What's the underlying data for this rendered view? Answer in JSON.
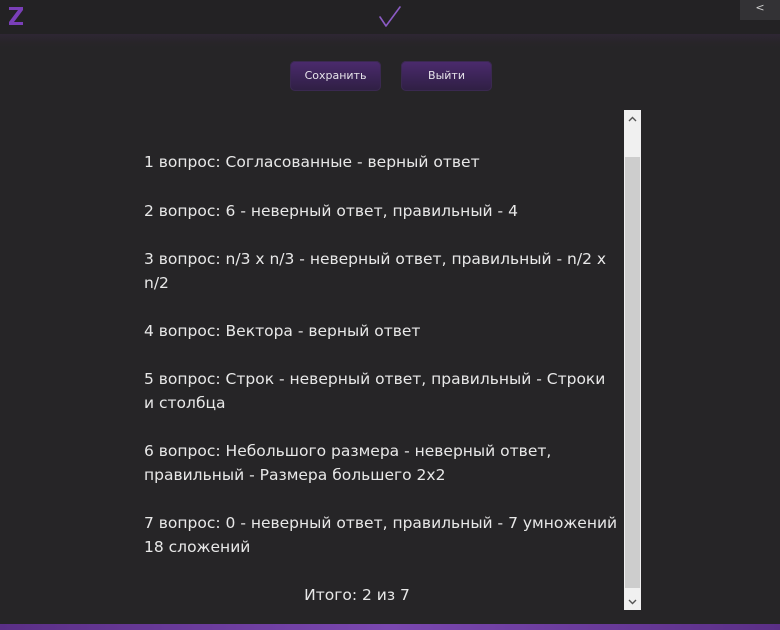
{
  "header": {
    "collapse_label": "<"
  },
  "toolbar": {
    "save_label": "Сохранить",
    "exit_label": "Выйти"
  },
  "results": {
    "lines": [
      "1 вопрос: Согласованные - верный ответ",
      "2 вопрос: 6 - неверный ответ, правильный - 4",
      "3 вопрос: n/3 x n/3 - неверный ответ, правильный - n/2 x n/2",
      "4 вопрос: Вектора - верный ответ",
      "5 вопрос: Строк - неверный ответ, правильный - Строки и столбца",
      "6 вопрос: Небольшого размера - неверный ответ, правильный - Размера большего 2х2",
      "7 вопрос: 0 - неверный ответ, правильный - 7 умножений 18 сложений"
    ],
    "total": "Итого: 2 из 7"
  },
  "icons": {
    "logo": "z-logo-icon",
    "center": "check-icon",
    "scroll_up": "chevron-up-icon",
    "scroll_down": "chevron-down-icon"
  },
  "colors": {
    "background": "#262527",
    "accent": "#7a48b0",
    "button": "#3b2456",
    "text": "#e8e8e8"
  }
}
